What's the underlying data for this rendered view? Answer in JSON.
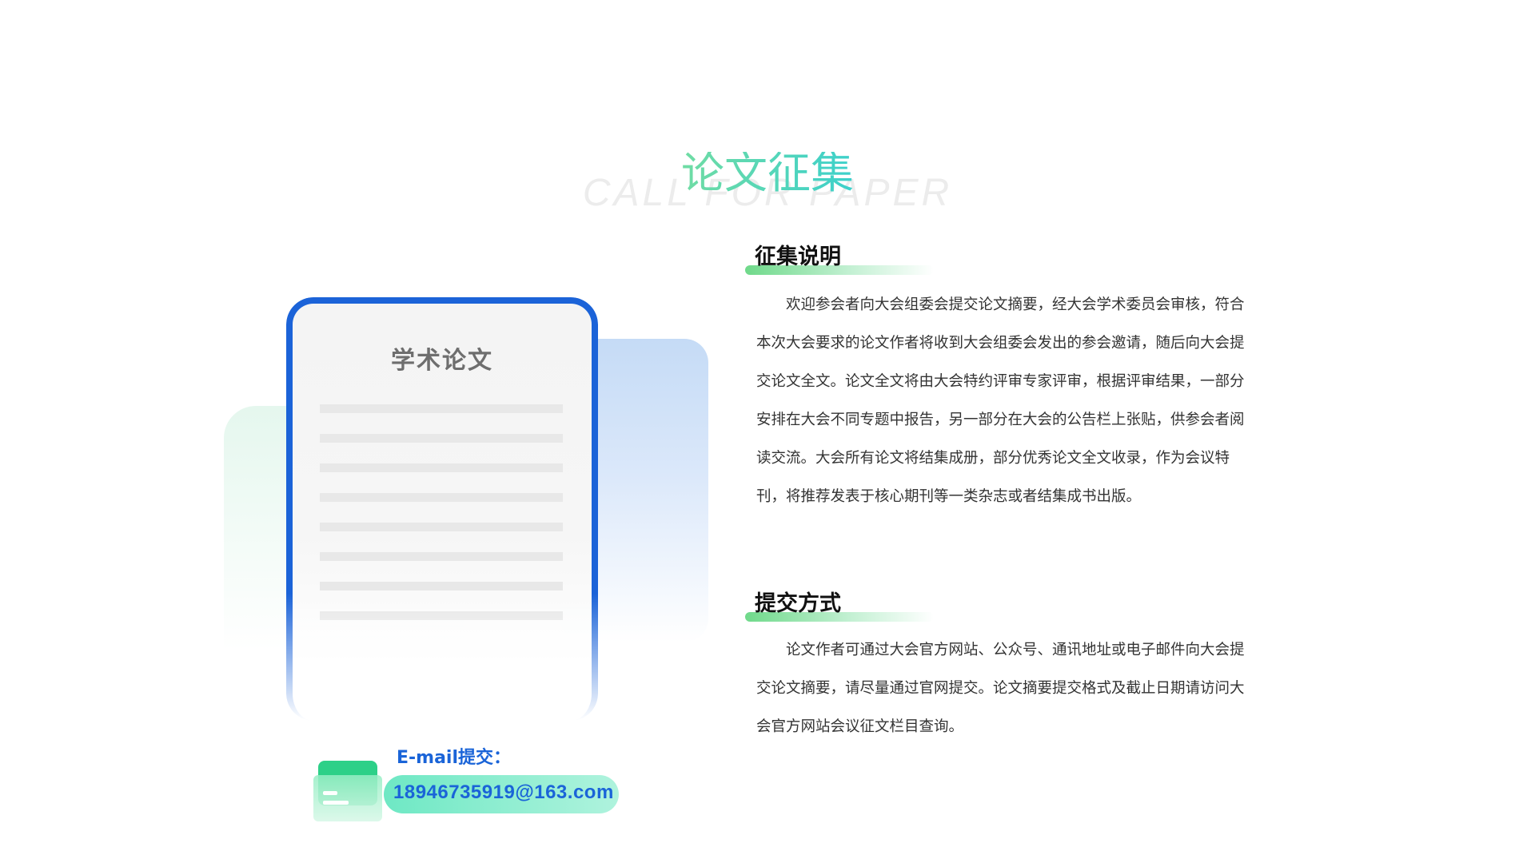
{
  "heading": {
    "title_cn": "论文征集",
    "title_en": "CALL FOR PAPER"
  },
  "illustration": {
    "paper_title": "学术论文"
  },
  "email": {
    "label": "E-mail提交：",
    "address": "18946735919@163.com"
  },
  "sections": [
    {
      "title": "征集说明",
      "text": "欢迎参会者向大会组委会提交论文摘要，经大会学术委员会审核，符合本次大会要求的论文作者将收到大会组委会发出的参会邀请，随后向大会提交论文全文。论文全文将由大会特约评审专家评审，根据评审结果，一部分安排在大会不同专题中报告，另一部分在大会的公告栏上张贴，供参会者阅读交流。大会所有论文将结集成册，部分优秀论文全文收录，作为会议特刊，将推荐发表于核心期刊等一类杂志或者结集成书出版。"
    },
    {
      "title": "提交方式",
      "text": "论文作者可通过大会官方网站、公众号、通讯地址或电子邮件向大会提交论文摘要，请尽量通过官网提交。论文摘要提交格式及截止日期请访问大会官方网站会议征文栏目查询。"
    }
  ],
  "colors": {
    "primary_blue": "#1b63d8",
    "accent_green": "#6fd98a",
    "heading_cyan": "#2bc2e6"
  }
}
